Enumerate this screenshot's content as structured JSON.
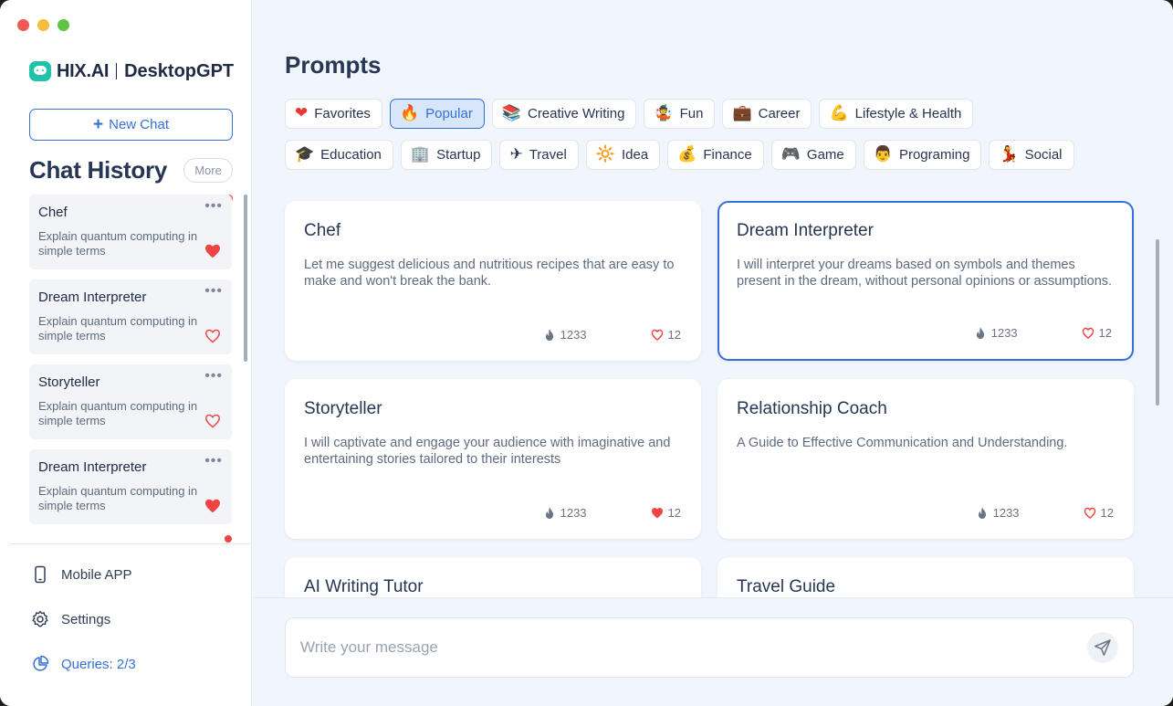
{
  "brand": {
    "name": "HIX.AI",
    "product": "DesktopGPT"
  },
  "sidebar": {
    "new_chat_label": "New Chat",
    "history_title": "Chat History",
    "more_label": "More",
    "history": [
      {
        "title": "Chef",
        "desc": "Explain quantum computing in simple terms",
        "favorited": true
      },
      {
        "title": "Dream Interpreter",
        "desc": "Explain quantum computing in simple terms",
        "favorited": false
      },
      {
        "title": "Storyteller",
        "desc": "Explain quantum computing in simple terms",
        "favorited": false
      },
      {
        "title": "Dream Interpreter",
        "desc": "Explain quantum computing in simple terms",
        "favorited": true
      }
    ],
    "mobile_app_label": "Mobile APP",
    "settings_label": "Settings",
    "queries_label": "Queries: 2/3"
  },
  "main": {
    "title": "Prompts",
    "tags_row1": [
      {
        "icon": "heart-icon",
        "emoji": "❤",
        "label": "Favorites"
      },
      {
        "icon": "fire-icon",
        "emoji": "🔥",
        "label": "Popular",
        "active": true
      },
      {
        "icon": "books-icon",
        "emoji": "📚",
        "label": "Creative Writing"
      },
      {
        "icon": "clown-icon",
        "emoji": "🤹",
        "label": "Fun"
      },
      {
        "icon": "briefcase-icon",
        "emoji": "💼",
        "label": "Career"
      },
      {
        "icon": "muscle-icon",
        "emoji": "💪",
        "label": "Lifestyle & Health"
      }
    ],
    "tags_row2": [
      {
        "icon": "graduation-cap-icon",
        "emoji": "🎓",
        "label": "Education"
      },
      {
        "icon": "office-building-icon",
        "emoji": "🏢",
        "label": "Startup"
      },
      {
        "icon": "airplane-icon",
        "emoji": "✈",
        "label": "Travel"
      },
      {
        "icon": "sun-icon",
        "emoji": "🔆",
        "label": "Idea"
      },
      {
        "icon": "money-bag-icon",
        "emoji": "💰",
        "label": "Finance"
      },
      {
        "icon": "gamepad-icon",
        "emoji": "🎮",
        "label": "Game"
      },
      {
        "icon": "technologist-icon",
        "emoji": "👨",
        "label": "Programing"
      },
      {
        "icon": "dancer-icon",
        "emoji": "💃",
        "label": "Social"
      }
    ],
    "cards": [
      {
        "title": "Chef",
        "desc": "Let me suggest delicious and nutritious recipes that are easy to make and won't break the bank.",
        "uses": "1233",
        "likes": "12",
        "liked": false
      },
      {
        "title": "Dream Interpreter",
        "desc": "I will interpret your dreams based on symbols and themes present in the dream, without personal opinions or assumptions.",
        "uses": "1233",
        "likes": "12",
        "liked": false,
        "selected": true
      },
      {
        "title": "Storyteller",
        "desc": "I will captivate and engage your audience with imaginative and entertaining stories tailored to their interests",
        "uses": "1233",
        "likes": "12",
        "liked": true
      },
      {
        "title": "Relationship Coach",
        "desc": "A Guide to Effective Communication and Understanding.",
        "uses": "1233",
        "likes": "12",
        "liked": false
      },
      {
        "title": "AI Writing Tutor",
        "desc": "",
        "uses": "",
        "likes": ""
      },
      {
        "title": "Travel Guide",
        "desc": "",
        "uses": "",
        "likes": ""
      }
    ],
    "composer": {
      "placeholder": "Write your message"
    }
  },
  "colors": {
    "accent": "#3470d8",
    "heart": "#ef4444",
    "brand": "#21c3a8"
  }
}
